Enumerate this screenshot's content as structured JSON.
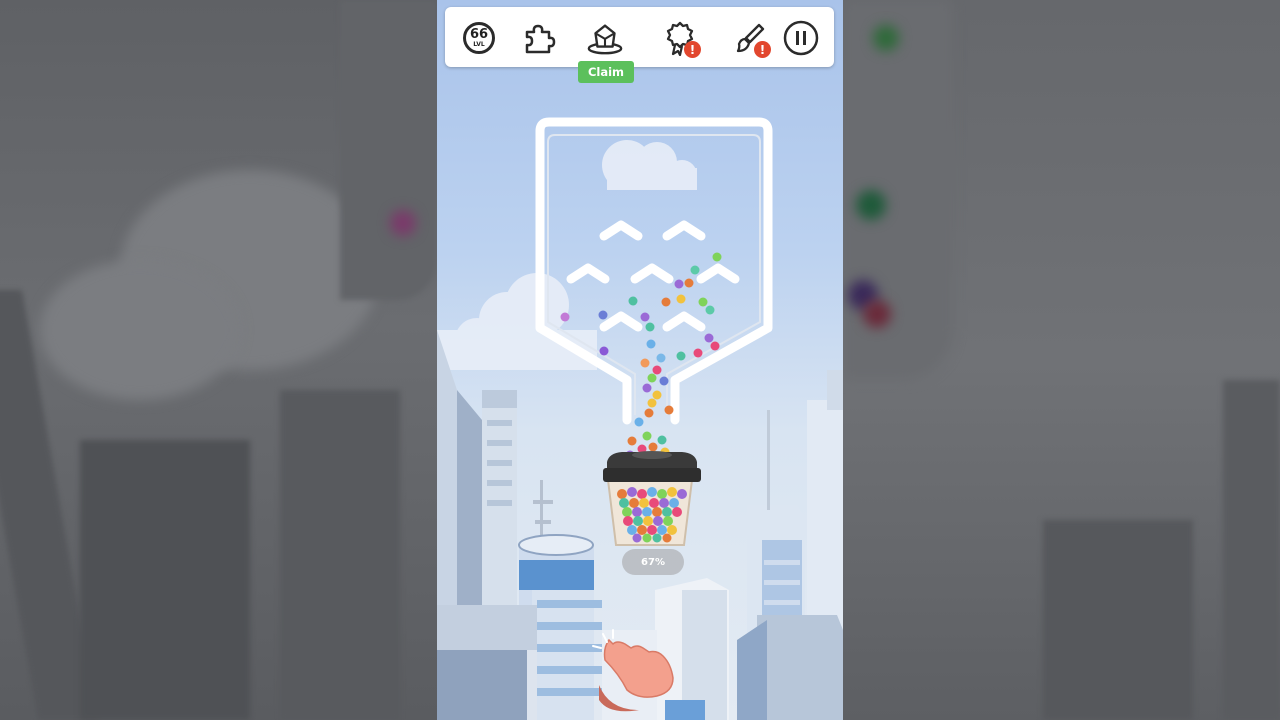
{
  "toolbar": {
    "level": {
      "number": "66",
      "suffix": "LVL"
    },
    "buttons": [
      "level",
      "puzzle",
      "cup-reward",
      "badge",
      "paint-brush",
      "pause"
    ],
    "claim_label": "Claim"
  },
  "game": {
    "progress_text": "67%",
    "fill_fraction": 0.67
  },
  "colors": {
    "claim": "#5cc05c",
    "alert": "#e2472e",
    "sky_top": "#a9c3ea",
    "cup_lid": "#2e2e2e"
  },
  "icons": [
    "level-icon",
    "puzzle-icon",
    "cup-reward-icon",
    "badge-icon",
    "paint-brush-icon",
    "pause-icon",
    "hand-cursor-icon"
  ]
}
